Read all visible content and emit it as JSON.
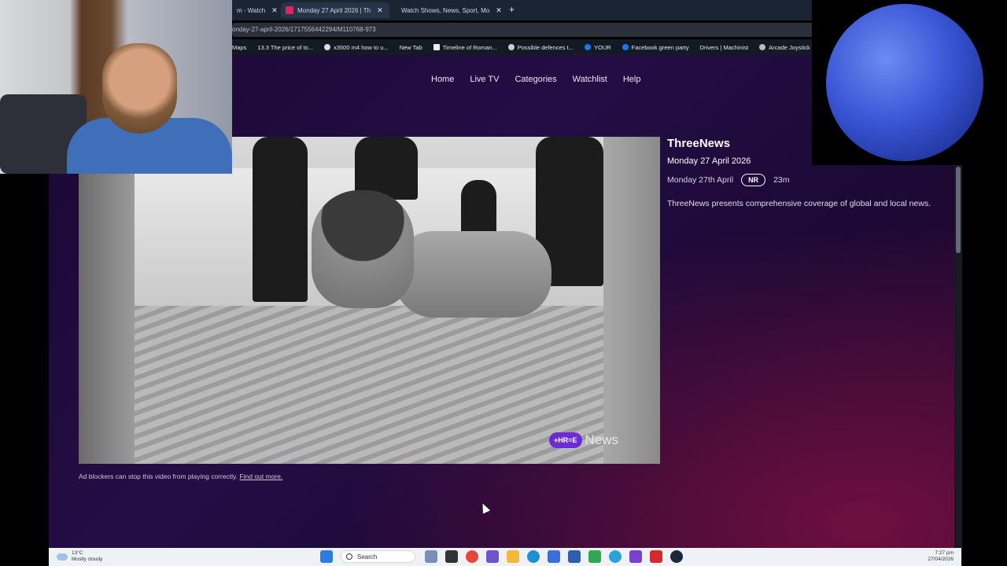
{
  "browser": {
    "tabs": [
      {
        "label": "m - Watch",
        "active": false
      },
      {
        "label": "Monday 27 April 2026 | Th",
        "active": true
      },
      {
        "label": "Watch Shows, News, Sport, Mo",
        "active": false
      }
    ],
    "new_tab": "+",
    "address": "onday-27-april-2026/1717556442294/M110768-973",
    "bookmarks": [
      "Maps",
      "13.3 The price of to...",
      "x3500 m4 how to u...",
      "New Tab",
      "Timeline of Roman...",
      "Possible defences t...",
      "YOUR",
      "Facebook green party",
      "Drivers | Machinist",
      "Arcade Joystick w"
    ]
  },
  "nav": {
    "items": [
      "Home",
      "Live TV",
      "Categories",
      "Watchlist",
      "Help"
    ]
  },
  "player": {
    "logo_pill": "+HR=E",
    "logo_text": "News",
    "ad_note": "Ad blockers can stop this video from playing correctly.",
    "ad_link": "Find out more."
  },
  "info": {
    "title": "ThreeNews",
    "date": "Monday 27 April 2026",
    "air_date": "Monday 27th April",
    "rating": "NR",
    "duration": "23m",
    "description": "ThreeNews presents comprehensive coverage of global and local news."
  },
  "taskbar": {
    "weather_temp": "13°C",
    "weather_desc": "Mostly cloudy",
    "search_label": "Search",
    "time": "7:27 pm",
    "date": "27/04/2026"
  },
  "colors": {
    "page_bg": "#1f0a3c",
    "accent_purple": "#6d2bd6",
    "taskbar_bg": "#eef1f6"
  }
}
